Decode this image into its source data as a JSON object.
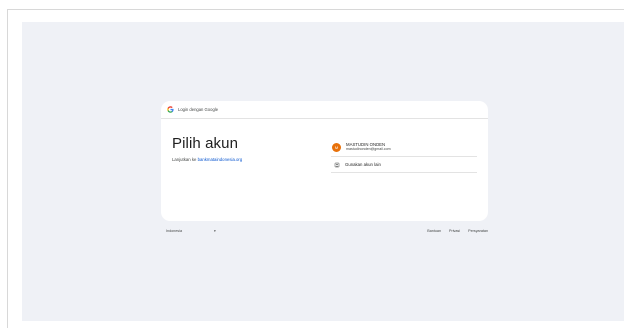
{
  "header": {
    "text": "Login dengan Google",
    "logo_icon": "google-g-icon"
  },
  "main": {
    "title": "Pilih akun",
    "continue_prefix": "Lanjutkan ke",
    "continue_link": "bankmataindonesia.org"
  },
  "accounts": [
    {
      "initial": "M",
      "name": "MASTUDIN ONDEN",
      "email": "mastudinonden@gmail.com"
    }
  ],
  "other_account": {
    "label": "Gunakan akun lain",
    "icon": "account-switch-icon"
  },
  "footer": {
    "language": "Indonesia",
    "links": [
      "Bantuan",
      "Privasi",
      "Persyaratan"
    ]
  },
  "colors": {
    "surface": "#eff1f6",
    "card": "#ffffff",
    "avatar": "#e8710a",
    "link": "#0b57d0"
  }
}
